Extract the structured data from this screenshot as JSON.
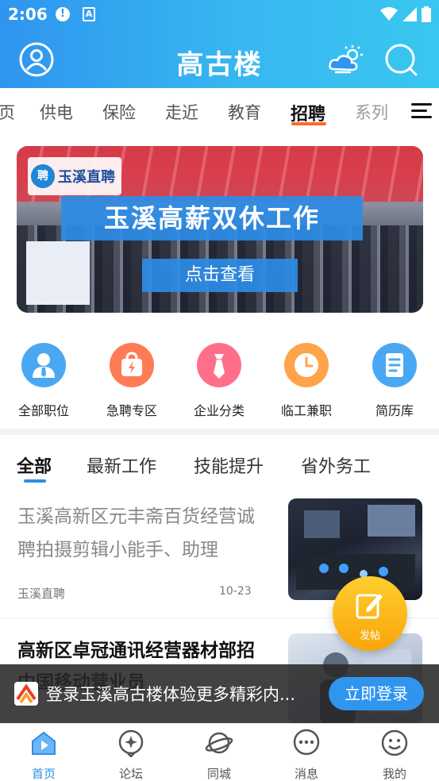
{
  "status_bar": {
    "time": "2:06",
    "alert_glyph": "!",
    "app_glyph": "A"
  },
  "header": {
    "title": "高古楼",
    "icons": [
      "user-icon",
      "weather-icon",
      "search-icon"
    ]
  },
  "tabs": {
    "items": [
      {
        "label": "页"
      },
      {
        "label": "供电"
      },
      {
        "label": "保险"
      },
      {
        "label": "走近"
      },
      {
        "label": "教育"
      },
      {
        "label": "招聘"
      },
      {
        "label": "系列"
      }
    ],
    "active": "招聘",
    "accent_color": "#ff6a2a"
  },
  "banner": {
    "logo_text": "玉溪直聘",
    "logo_mark": "聘",
    "headline": "玉溪高薪双休工作",
    "cta": "点击查看"
  },
  "quick_menu": [
    {
      "label": "全部职位",
      "icon": "person-badge-icon",
      "color": "#4aa8f3"
    },
    {
      "label": "急聘专区",
      "icon": "lightning-bag-icon",
      "color": "#ff7b55"
    },
    {
      "label": "企业分类",
      "icon": "tie-icon",
      "color": "#ff6f8a"
    },
    {
      "label": "临工兼职",
      "icon": "clock-icon",
      "color": "#ffa44a"
    },
    {
      "label": "简历库",
      "icon": "document-icon",
      "color": "#4aa8f3"
    }
  ],
  "sub_tabs": {
    "items": [
      {
        "label": "全部"
      },
      {
        "label": "最新工作"
      },
      {
        "label": "技能提升"
      },
      {
        "label": "省外务工"
      }
    ],
    "active": "全部"
  },
  "news": [
    {
      "title": "玉溪高新区元丰斋百货经营诚聘拍摄剪辑小能手、助理",
      "source": "玉溪直聘",
      "date": "10-23",
      "read": true
    },
    {
      "title": "高新区卓冠通讯经营器材部招中国移动营业员",
      "read": false
    }
  ],
  "fab": {
    "label": "发帖"
  },
  "login_prompt": {
    "text": "登录玉溪高古楼体验更多精彩内...",
    "button": "立即登录"
  },
  "bottom_nav": {
    "items": [
      {
        "label": "首页",
        "icon": "home-icon"
      },
      {
        "label": "论坛",
        "icon": "forum-icon"
      },
      {
        "label": "同城",
        "icon": "planet-icon"
      },
      {
        "label": "消息",
        "icon": "message-icon"
      },
      {
        "label": "我的",
        "icon": "smile-icon"
      }
    ],
    "active": "首页"
  },
  "colors": {
    "header_start": "#2f95ef",
    "header_end": "#39c7f0",
    "nav_active": "#2f8de4",
    "fab": "#fbb51d"
  }
}
